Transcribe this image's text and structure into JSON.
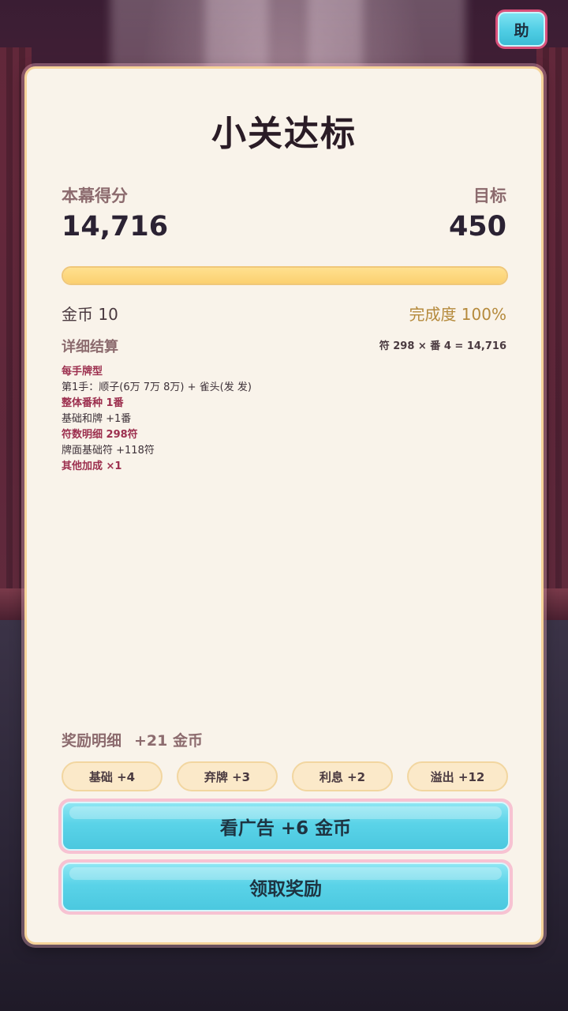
{
  "help_button": {
    "label": "助"
  },
  "result": {
    "title": "小关达标",
    "score_label": "本幕得分",
    "score_value": "14,716",
    "target_label": "目标",
    "target_value": "450",
    "progress_fraction": 1.0,
    "gold_text": "金币 10",
    "completion_text": "完成度 100%"
  },
  "details": {
    "heading": "详细结算",
    "formula": "符 298 × 番 4 = 14,716",
    "lines": [
      {
        "text": "每手牌型",
        "style": "hl"
      },
      {
        "text": "第1手：顺子(6万 7万 8万) + 雀头(发 发)",
        "style": "norm"
      },
      {
        "text": "整体番种 1番",
        "style": "hl"
      },
      {
        "text": "基础和牌 +1番",
        "style": "norm"
      },
      {
        "text": "符数明细 298符",
        "style": "hl"
      },
      {
        "text": "牌面基础符 +118符",
        "style": "norm"
      },
      {
        "text": "其他加成 ×1",
        "style": "hl"
      }
    ]
  },
  "rewards": {
    "heading": "奖励明细",
    "total": "+21 金币",
    "chips": [
      {
        "label": "基础 +4"
      },
      {
        "label": "弃牌 +3"
      },
      {
        "label": "利息 +2"
      },
      {
        "label": "溢出 +12"
      }
    ]
  },
  "buttons": {
    "watch_ad": "看广告 +6 金币",
    "claim": "领取奖励"
  },
  "colors": {
    "panel_bg": "#f9f3ea",
    "panel_border": "#f6d49a",
    "button_cyan": "#5ad3e8",
    "button_border_pink": "#f7c2d2",
    "progress_fill": "#fbd070",
    "highlight_text": "#9c2f4e",
    "label_text": "#8c6b6e",
    "completion_gold": "#b58a3c"
  }
}
